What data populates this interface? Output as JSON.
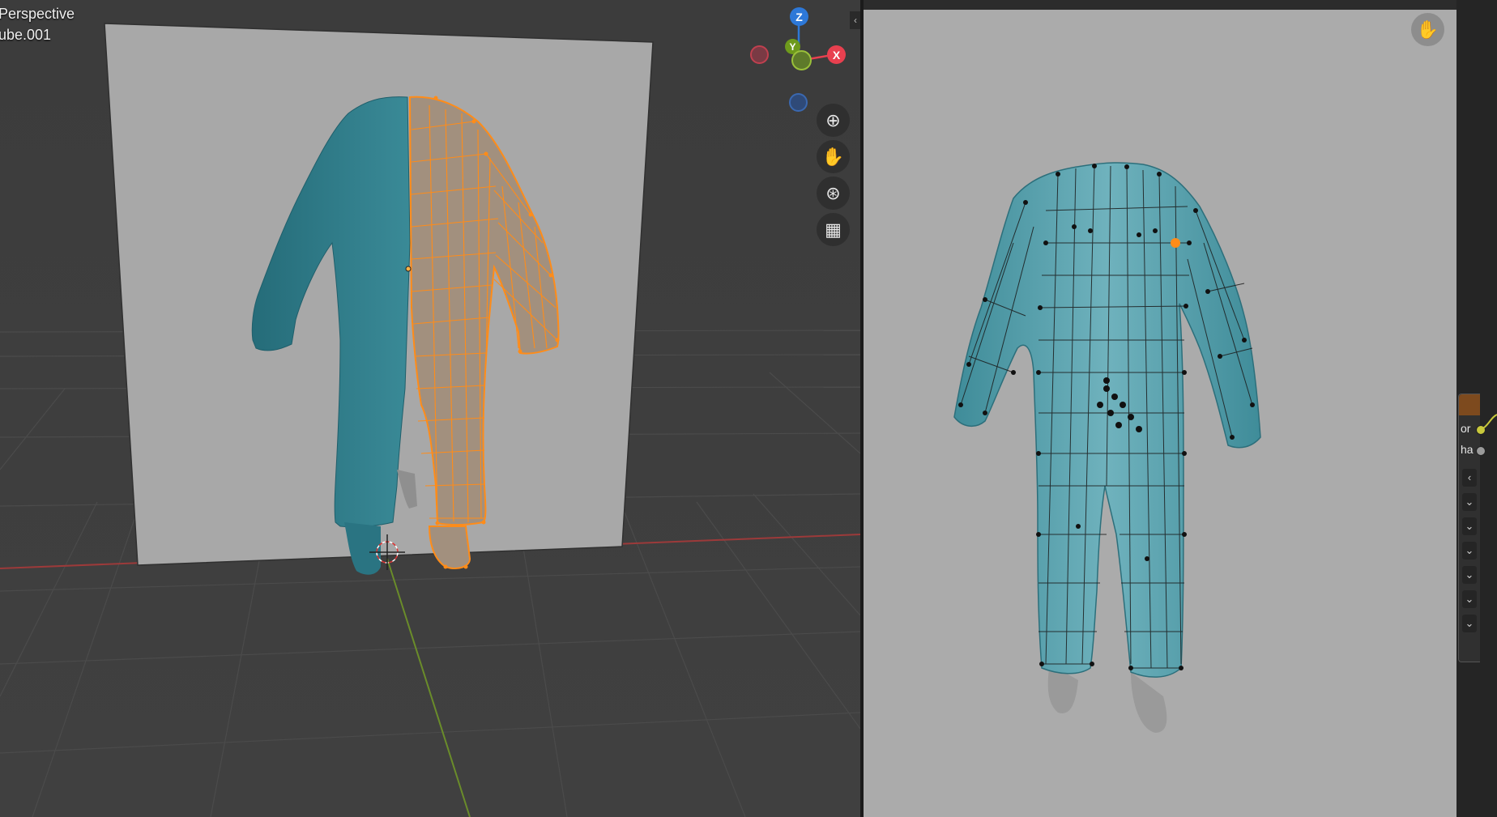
{
  "viewport": {
    "mode_label": "Perspective",
    "object_label": "ube.001",
    "gizmo": {
      "z_label": "Z",
      "y_label": "Y",
      "x_label": "X",
      "colors": {
        "x": "#e8404f",
        "y": "#6e9a1c",
        "z": "#2d78d8"
      }
    },
    "nav_buttons": [
      {
        "name": "zoom-icon",
        "glyph": "⊕"
      },
      {
        "name": "hand-icon",
        "glyph": "✋"
      },
      {
        "name": "camera-icon",
        "glyph": "⊛"
      },
      {
        "name": "grid-icon",
        "glyph": "▦"
      }
    ],
    "collapse_glyph": "‹"
  },
  "render": {
    "pan_glyph": "✋"
  },
  "node_panel": {
    "sockets": [
      {
        "label": "or",
        "color": "#c8c83c"
      },
      {
        "label": "ha",
        "color": "#9a9a9a"
      }
    ],
    "collapse_glyph": "‹",
    "chevron_glyph": "⌄",
    "header_color": "#7d4a1e"
  },
  "colors": {
    "cloth": "#2f7e8c",
    "selection": "#ff8c19"
  }
}
